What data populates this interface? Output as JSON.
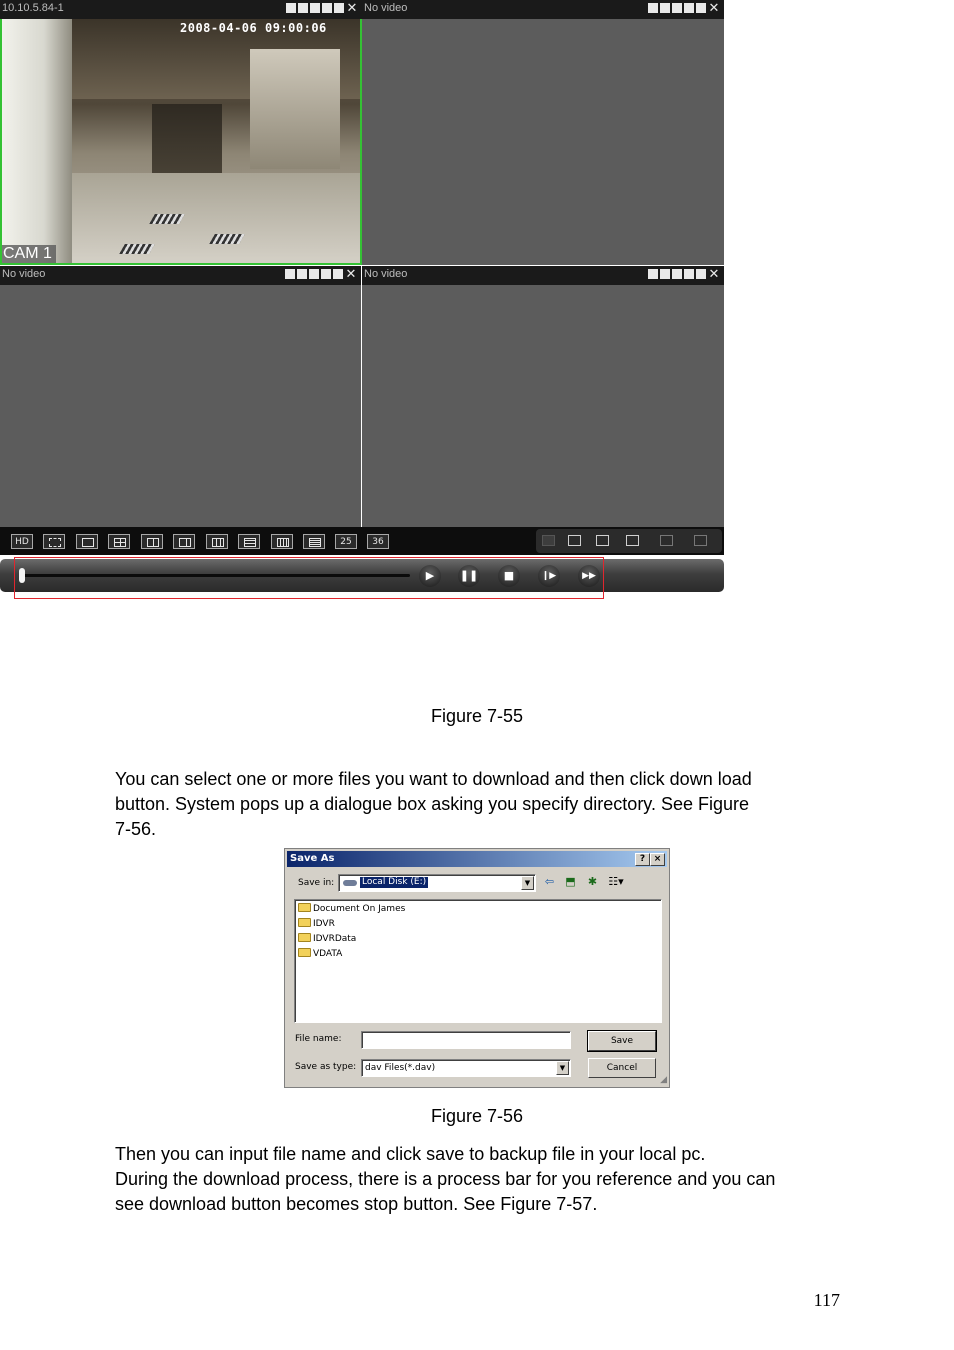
{
  "figure_55": {
    "caption": "Figure 7-55",
    "panes": [
      {
        "label": "10.10.5.84-1",
        "timestamp": "2008-04-06 09:00:06",
        "camera_name": "CAM 1",
        "selected": true
      },
      {
        "label": "No video"
      },
      {
        "label": "No video"
      },
      {
        "label": "No video"
      }
    ],
    "toolbar_buttons": [
      "HD",
      "fullscreen",
      "1",
      "4",
      "6",
      "8",
      "9",
      "13",
      "16",
      "20",
      "25",
      "36"
    ],
    "playback": {
      "progress": 0,
      "buttons": [
        "play",
        "pause",
        "stop",
        "step-forward",
        "fast-forward"
      ]
    },
    "highlight_color": "#e0262e"
  },
  "paragraph_1": {
    "lines": [
      "You can select one or more files you want to download and then click down load",
      "button. System pops up a dialogue box asking you specify directory.  See Figure",
      "7-56."
    ]
  },
  "figure_56": {
    "caption": "Figure 7-56",
    "dialog": {
      "title": "Save As",
      "help_button": "?",
      "close_button": "×",
      "save_in_label": "Save in:",
      "save_in_value": "Local Disk (E:)",
      "folders": [
        "Document On James",
        "IDVR",
        "IDVRData",
        "VDATA"
      ],
      "file_name_label": "File name:",
      "file_name_value": "",
      "save_as_type_label": "Save as type:",
      "save_as_type_value": "dav Files(*.dav)",
      "save_button": "Save",
      "cancel_button": "Cancel"
    }
  },
  "paragraph_2": {
    "lines": [
      "Then you can input file name and click save to backup file in your local pc.",
      "During the download process, there is a process bar for you reference and you can",
      "see download button becomes stop button. See Figure 7-57."
    ]
  },
  "page_number": "117"
}
